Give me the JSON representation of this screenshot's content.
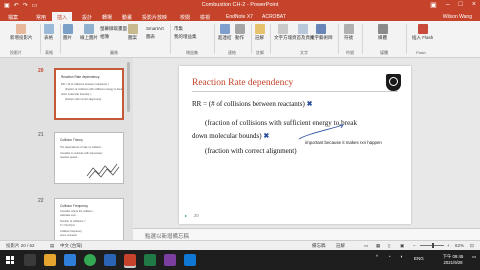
{
  "window": {
    "title": "Combustion CH-2 - PowerPoint",
    "user": "Wilson Wang"
  },
  "tabs": [
    "檔案",
    "常用",
    "插入",
    "設計",
    "轉場",
    "動畫",
    "投影片放映",
    "校閱",
    "檢視",
    "EndNote X7",
    "ACROBAT"
  ],
  "ribbon": {
    "new_slide": "新增投影片",
    "layout": "表格",
    "image": "圖片",
    "online_image": "線上圖片",
    "screenshot": "螢幕擷取畫面",
    "album": "相簿",
    "shapes": "圖案",
    "smartart": "SmartArt",
    "chart": "圖表",
    "store": "市集",
    "my_addins": "我的增益集",
    "link": "超連結",
    "action": "動作",
    "comment": "註解",
    "textbox": "文字方塊",
    "header_footer": "頁首及頁尾",
    "wordart": "文字藝術師",
    "symbol": "符號",
    "media": "媒體",
    "flash": "插入 Flash",
    "sections": [
      "投影片",
      "表格",
      "圖像",
      "增益集",
      "連結",
      "註解",
      "文字",
      "符號",
      "媒體",
      "Flash"
    ]
  },
  "thumbnails": [
    {
      "num": "20",
      "title": "Reaction Rate dependency",
      "lines": [
        "RR = (# of collisions between reactants) ×",
        "(fraction of collisions with sufficient energy to break",
        "down molecular bounds) ×",
        "(fraction with correct alignment)"
      ]
    },
    {
      "num": "21",
      "title": "Collision Theory",
      "lines": [
        "The dependence of rate on collision...",
        "Consider a molecule with elementary",
        "reaction speed..."
      ]
    },
    {
      "num": "22",
      "title": "Collision Frequency",
      "lines": [
        "Consider where the collision...",
        "calculate sum ...",
        "Number of collisions =",
        "Z = N(n/V)σv",
        "Collision frequency",
        "some constant"
      ]
    }
  ],
  "slide": {
    "title": "Reaction Rate dependency",
    "line1": "RR = (# of collisions between reactants) ",
    "line2": "(fraction of collisions with sufficient energy to break",
    "line3": "down molecular bounds) ",
    "line4": "(fraction with correct alignment)",
    "annotation": "important because it makes rxn happen",
    "number": "20"
  },
  "notes_placeholder": "點選以新增備忘稿",
  "status": {
    "slide_info": "投影片 20 / 62",
    "language": "中文 (台灣)",
    "notes": "備忘稿",
    "comments": "註解",
    "zoom": "62%"
  },
  "taskbar": {
    "lang": "ENG",
    "time": "下午 09:45",
    "date": "2021/9/28"
  }
}
